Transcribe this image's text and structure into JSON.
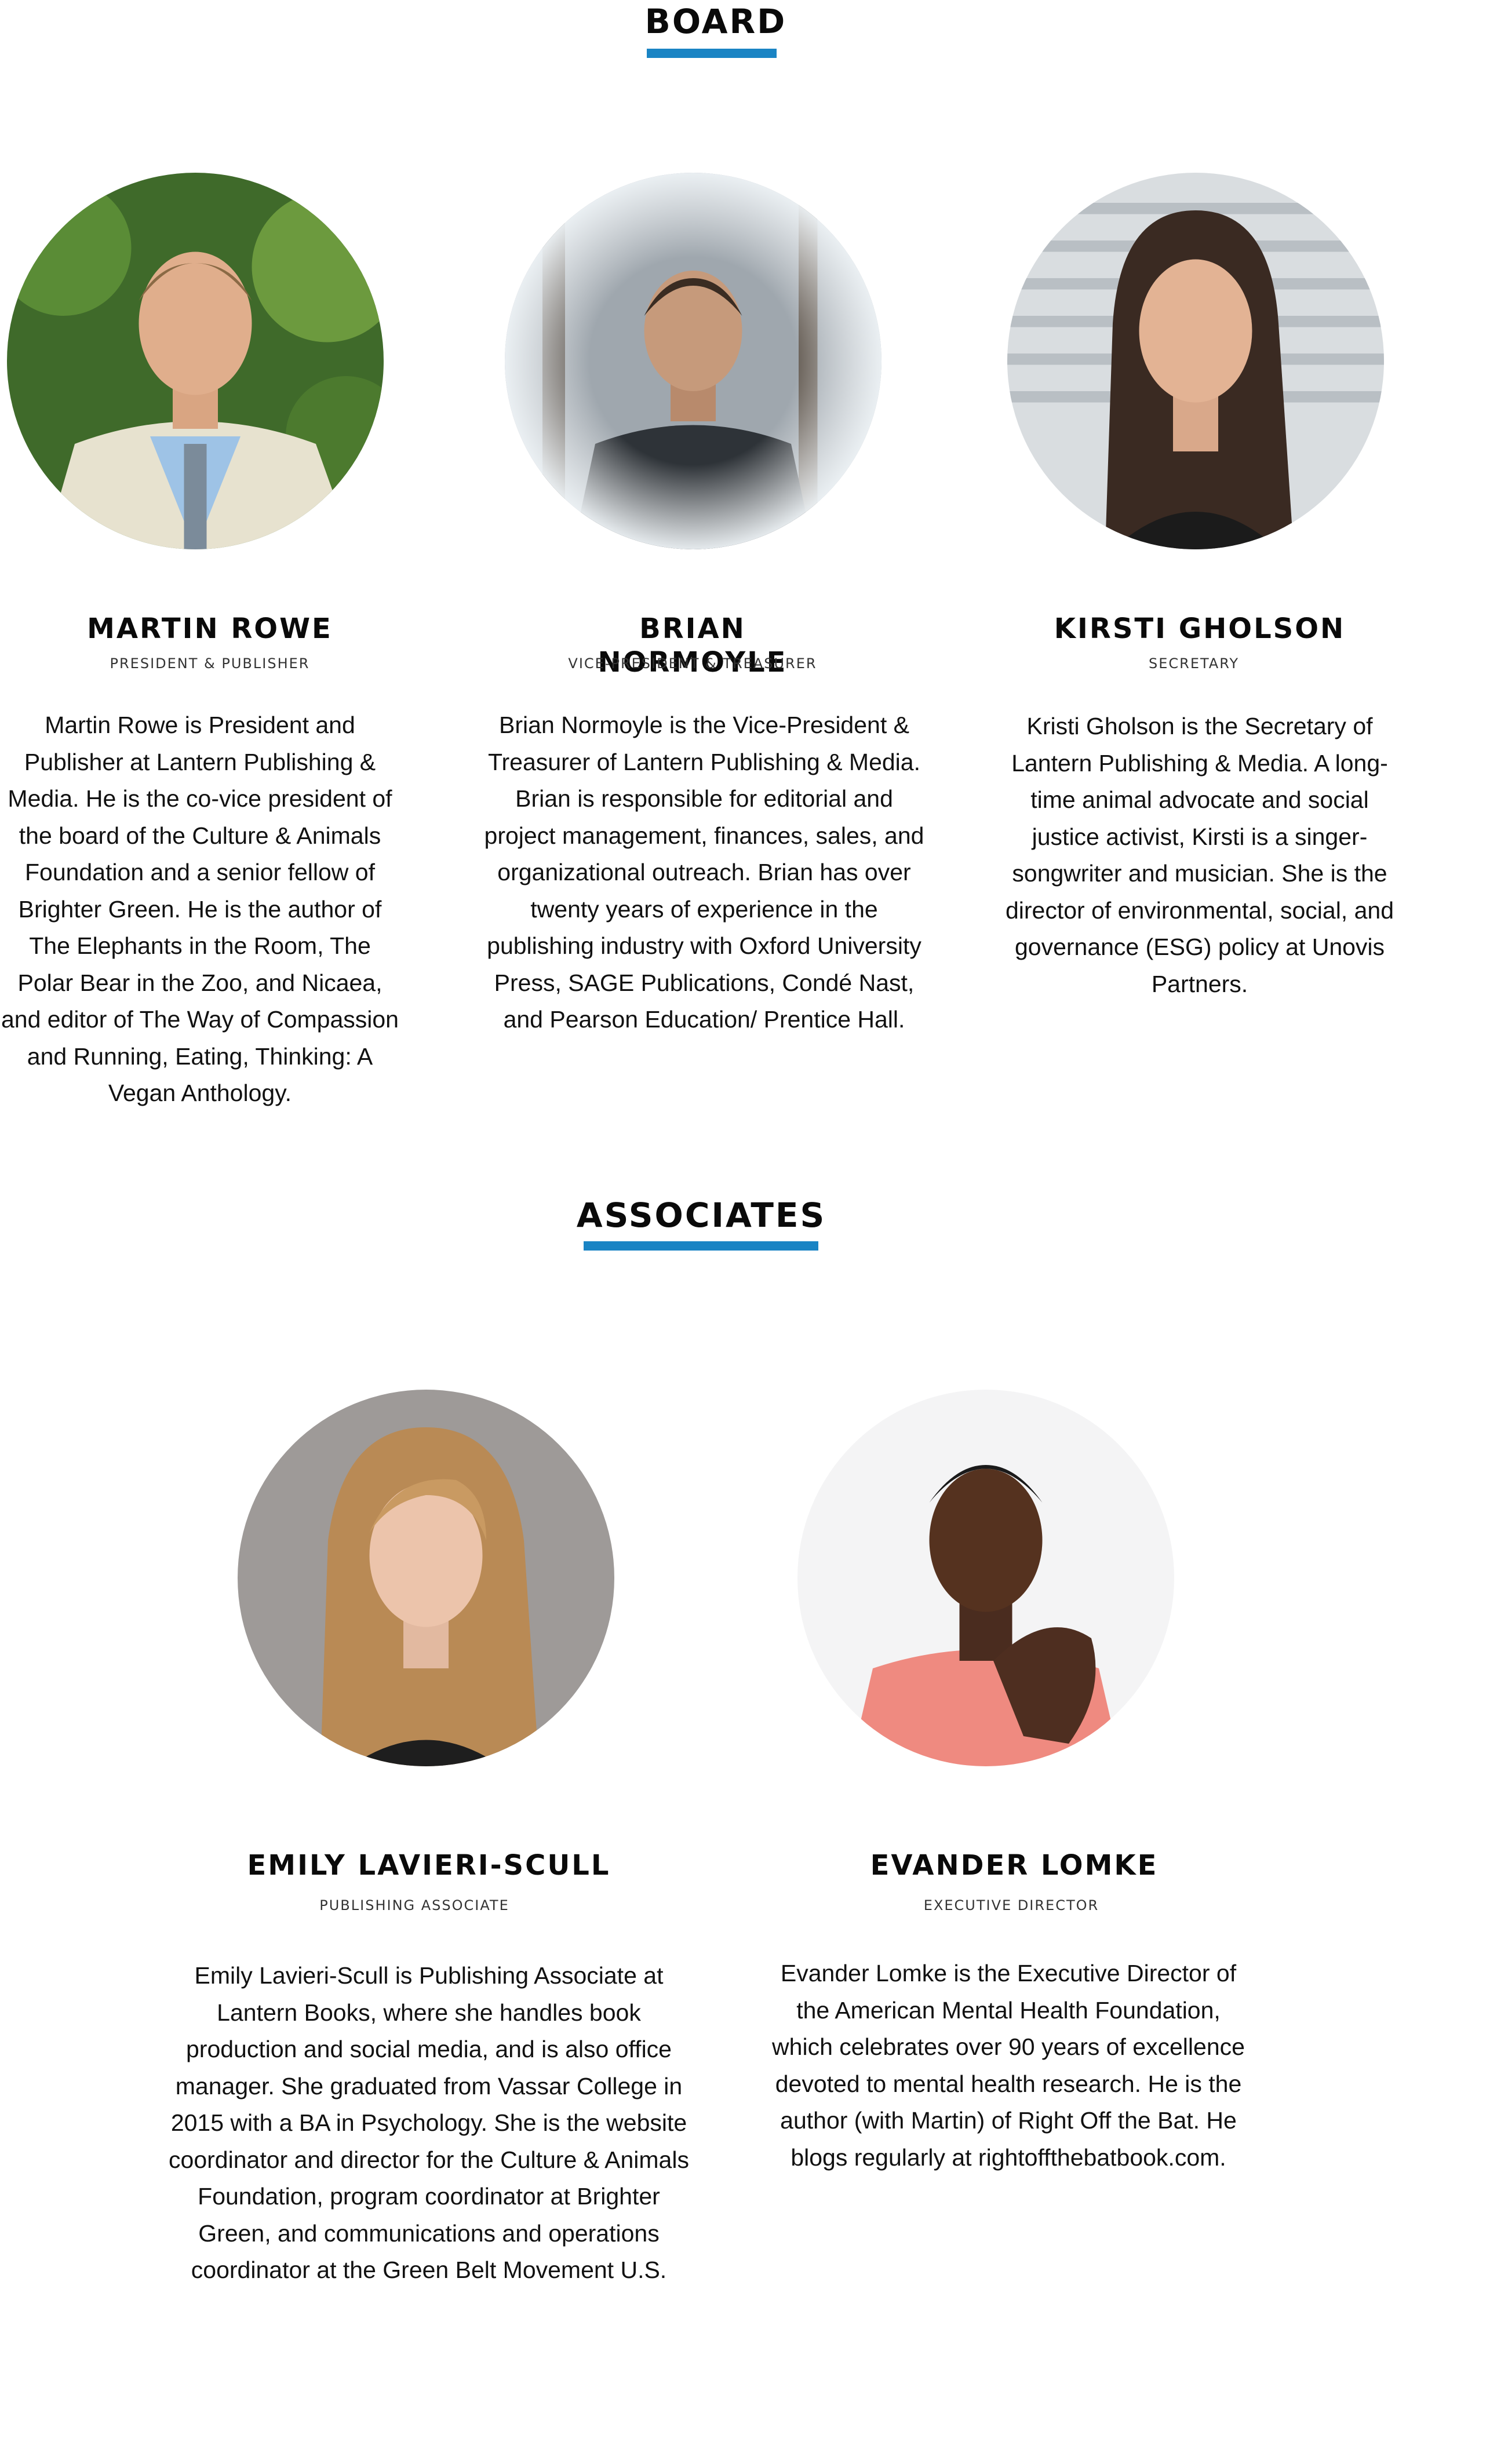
{
  "sections": {
    "board": {
      "title": "BOARD",
      "members": [
        {
          "name": "MARTIN ROWE",
          "role": "PRESIDENT & PUBLISHER",
          "bio": "Martin Rowe is President and Publisher at Lantern Publishing & Media. He is the co-vice president of the board of the Culture & Animals Foundation and a senior fellow of Brighter Green. He is the author of The Elephants in the Room, The Polar Bear in the Zoo, and Nicaea, and editor of The Way of Compassion and Running, Eating, Thinking: A Vegan Anthology.",
          "photo": "man-in-suit-portrait"
        },
        {
          "name": "BRIAN NORMOYLE",
          "role": "VICE-PRESIDENT & TREASURER",
          "bio": "Brian Normoyle is the Vice-President & Treasurer of Lantern Publishing & Media. Brian is responsible for editorial and project management, finances, sales, and organizational outreach. Brian has over twenty years of experience in the publishing industry with Oxford University Press, SAGE Publications, Condé Nast, and Pearson Education/ Prentice Hall.",
          "photo": "man-outdoors-winter-portrait"
        },
        {
          "name": "KIRSTI GHOLSON",
          "role": "SECRETARY",
          "bio": "Kristi Gholson is the Secretary of Lantern Publishing & Media. A long-time animal advocate and social justice activist, Kirsti is a singer-songwriter and musician. She is the director of environmental, social, and governance (ESG) policy at Unovis Partners.",
          "photo": "smiling-woman-portrait"
        }
      ]
    },
    "associates": {
      "title": "ASSOCIATES",
      "members": [
        {
          "name": "EMILY LAVIERI-SCULL",
          "role": "PUBLISHING ASSOCIATE",
          "bio": "Emily Lavieri-Scull is Publishing Associate at Lantern Books, where she handles book production and social media, and is also office manager. She graduated from Vassar College in 2015 with a BA in Psychology. She is the website coordinator and director for the Culture & Animals Foundation, program coordinator at Brighter Green, and communications and operations coordinator at the Green Belt Movement U.S.",
          "photo": "blonde-woman-portrait"
        },
        {
          "name": "EVANDER LOMKE",
          "role": "EXECUTIVE DIRECTOR",
          "bio": "Evander Lomke is the Executive Director of the American Mental Health Foundation, which celebrates over 90 years of excellence devoted to mental health research. He is the author (with Martin) of Right Off the Bat. He blogs regularly at rightoffthebatbook.com.",
          "photo": "man-hand-on-chin-portrait"
        }
      ]
    }
  },
  "colors": {
    "accent": "#1a84c4",
    "text": "#111111",
    "background": "#ffffff"
  }
}
